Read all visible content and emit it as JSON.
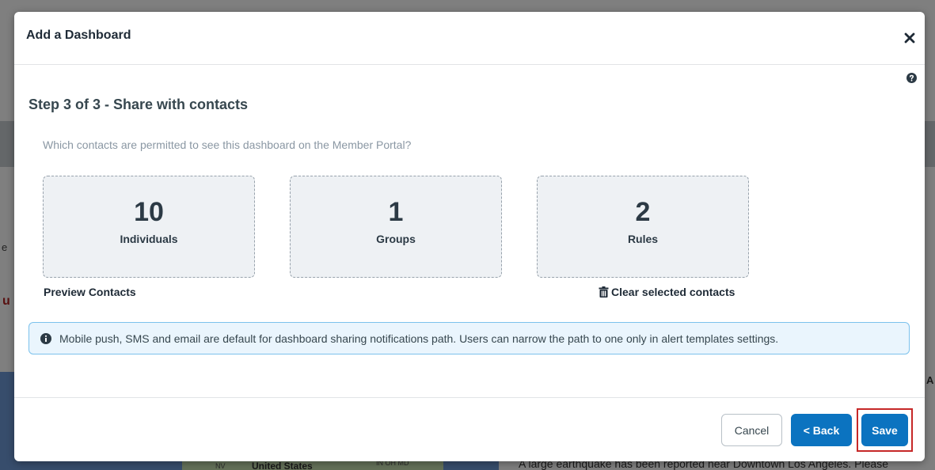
{
  "background": {
    "map_label": "United States",
    "map_small_1": "NV",
    "map_small_2": "IN OH MD",
    "news_text": "A large earthquake has been reported near Downtown Los Angeles. Please",
    "partial_red_text": "u",
    "partial_text_left": "e",
    "partial_text_right": "A"
  },
  "modal": {
    "title": "Add a Dashboard",
    "step_title": "Step 3 of 3 - Share with contacts",
    "question": "Which contacts are permitted to see this dashboard on the Member Portal?",
    "cards": [
      {
        "count": "10",
        "label": "Individuals"
      },
      {
        "count": "1",
        "label": "Groups"
      },
      {
        "count": "2",
        "label": "Rules"
      }
    ],
    "preview_contacts": "Preview Contacts",
    "clear_selected": "Clear selected contacts",
    "info_message": "Mobile push, SMS and email are default for dashboard sharing notifications path. Users can narrow the path to one only in alert templates settings.",
    "buttons": {
      "cancel": "Cancel",
      "back": "< Back",
      "save": "Save"
    }
  },
  "colors": {
    "primary": "#0b73c0",
    "highlight": "#c62828",
    "info_border": "#7cc2ec",
    "info_bg": "#eaf5fd"
  },
  "icons": [
    "close-icon",
    "help-icon",
    "trash-icon",
    "info-icon"
  ]
}
